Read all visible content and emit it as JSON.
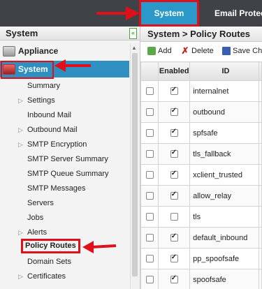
{
  "topnav": {
    "tabs": [
      {
        "label": "System",
        "active": true
      },
      {
        "label": "Email Protec"
      }
    ]
  },
  "sidebar": {
    "title": "System",
    "collapse_icon": "double-chevron-left-icon",
    "top_items": [
      {
        "label": "Appliance",
        "icon": "appliance-icon"
      },
      {
        "label": "System",
        "icon": "trash-system-icon",
        "selected": true
      }
    ],
    "sub_items": [
      {
        "label": "Summary",
        "expandable": false
      },
      {
        "label": "Settings",
        "expandable": true
      },
      {
        "label": "Inbound Mail",
        "expandable": false
      },
      {
        "label": "Outbound Mail",
        "expandable": true
      },
      {
        "label": "SMTP Encryption",
        "expandable": true
      },
      {
        "label": "SMTP Server Summary",
        "expandable": false
      },
      {
        "label": "SMTP Queue Summary",
        "expandable": false
      },
      {
        "label": "SMTP Messages",
        "expandable": false
      },
      {
        "label": "Servers",
        "expandable": false
      },
      {
        "label": "Jobs",
        "expandable": false
      },
      {
        "label": "Alerts",
        "expandable": true
      },
      {
        "label": "Policy Routes",
        "expandable": false,
        "active": true
      },
      {
        "label": "Domain Sets",
        "expandable": false
      },
      {
        "label": "Certificates",
        "expandable": true
      }
    ]
  },
  "main": {
    "title": "System > Policy Routes",
    "toolbar": {
      "add": "Add",
      "delete": "Delete",
      "save": "Save Ch"
    },
    "columns": [
      "Enabled",
      "ID"
    ],
    "rows": [
      {
        "id": "internalnet",
        "enabled": true
      },
      {
        "id": "outbound",
        "enabled": true
      },
      {
        "id": "spfsafe",
        "enabled": true
      },
      {
        "id": "tls_fallback",
        "enabled": true
      },
      {
        "id": "xclient_trusted",
        "enabled": true
      },
      {
        "id": "allow_relay",
        "enabled": true
      },
      {
        "id": "tls",
        "enabled": false
      },
      {
        "id": "default_inbound",
        "enabled": true
      },
      {
        "id": "pp_spoofsafe",
        "enabled": true
      },
      {
        "id": "spoofsafe",
        "enabled": true
      }
    ]
  },
  "colors": {
    "topbar": "#3f4347",
    "accent": "#2f8fc0",
    "annotation_red": "#e0101a"
  }
}
